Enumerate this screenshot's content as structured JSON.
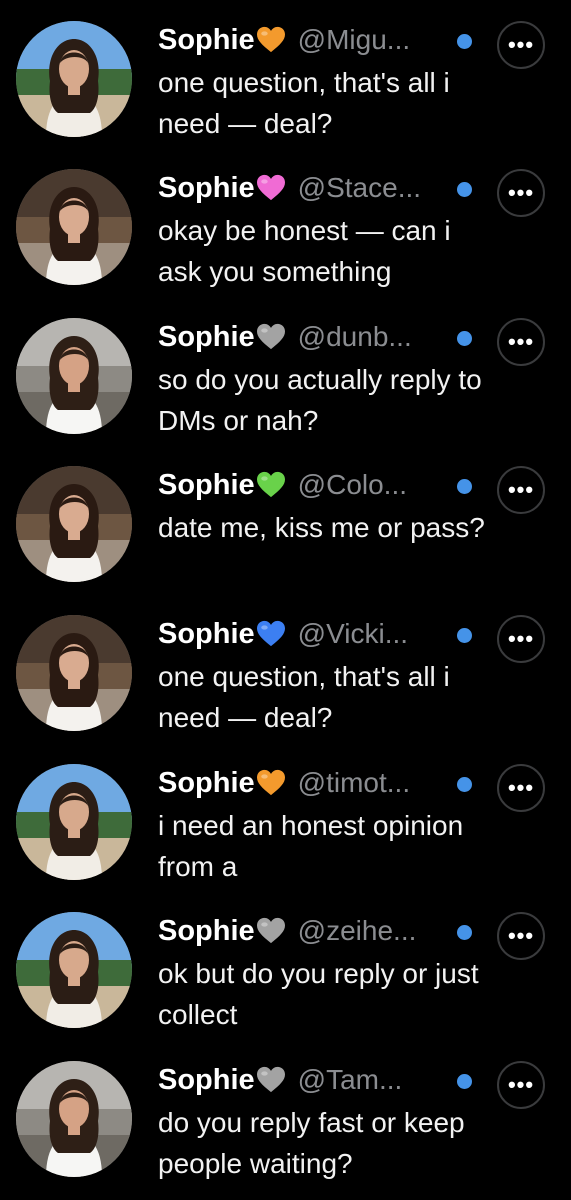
{
  "colors": {
    "background": "#000000",
    "name_text": "#ffffff",
    "handle_text": "#8b8d91",
    "message_text": "#f2f2f2",
    "unread_dot": "#4593e8",
    "more_button_border": "#3a3b3d"
  },
  "conversations": [
    {
      "name": "Sophie",
      "heart_icon": "orange-heart-icon",
      "heart_color": "#f39a2d",
      "handle": "@Migu...",
      "message": "one question, that's all i need — deal?",
      "unread": true,
      "more_label": "•••"
    },
    {
      "name": "Sophie",
      "heart_icon": "pink-heart-icon",
      "heart_color": "#f06bd4",
      "handle": "@Stace...",
      "message": "okay be honest — can i ask you something",
      "unread": true,
      "more_label": "•••"
    },
    {
      "name": "Sophie",
      "heart_icon": "grey-heart-icon",
      "heart_color": "#a3a3a3",
      "handle": "@dunb...",
      "message": "so do you actually reply to DMs or nah?",
      "unread": true,
      "more_label": "•••"
    },
    {
      "name": "Sophie",
      "heart_icon": "green-heart-icon",
      "heart_color": "#69d24a",
      "handle": "@Colo...",
      "message": "date me, kiss me or pass?",
      "unread": true,
      "more_label": "•••"
    },
    {
      "name": "Sophie",
      "heart_icon": "blue-heart-icon",
      "heart_color": "#3c7ff2",
      "handle": "@Vicki...",
      "message": "one question, that's all i need — deal?",
      "unread": true,
      "more_label": "•••"
    },
    {
      "name": "Sophie",
      "heart_icon": "orange-heart-icon",
      "heart_color": "#f39a2d",
      "handle": "@timot...",
      "message": "i need an honest opinion from a",
      "unread": true,
      "more_label": "•••"
    },
    {
      "name": "Sophie",
      "heart_icon": "grey-heart-icon",
      "heart_color": "#a3a3a3",
      "handle": "@zeihe...",
      "message": "ok but do you reply or just collect",
      "unread": true,
      "more_label": "•••"
    },
    {
      "name": "Sophie",
      "heart_icon": "grey-heart-icon",
      "heart_color": "#a3a3a3",
      "handle": "@Tam...",
      "message": "do you reply fast or keep people waiting?",
      "unread": true,
      "more_label": "•••"
    }
  ]
}
